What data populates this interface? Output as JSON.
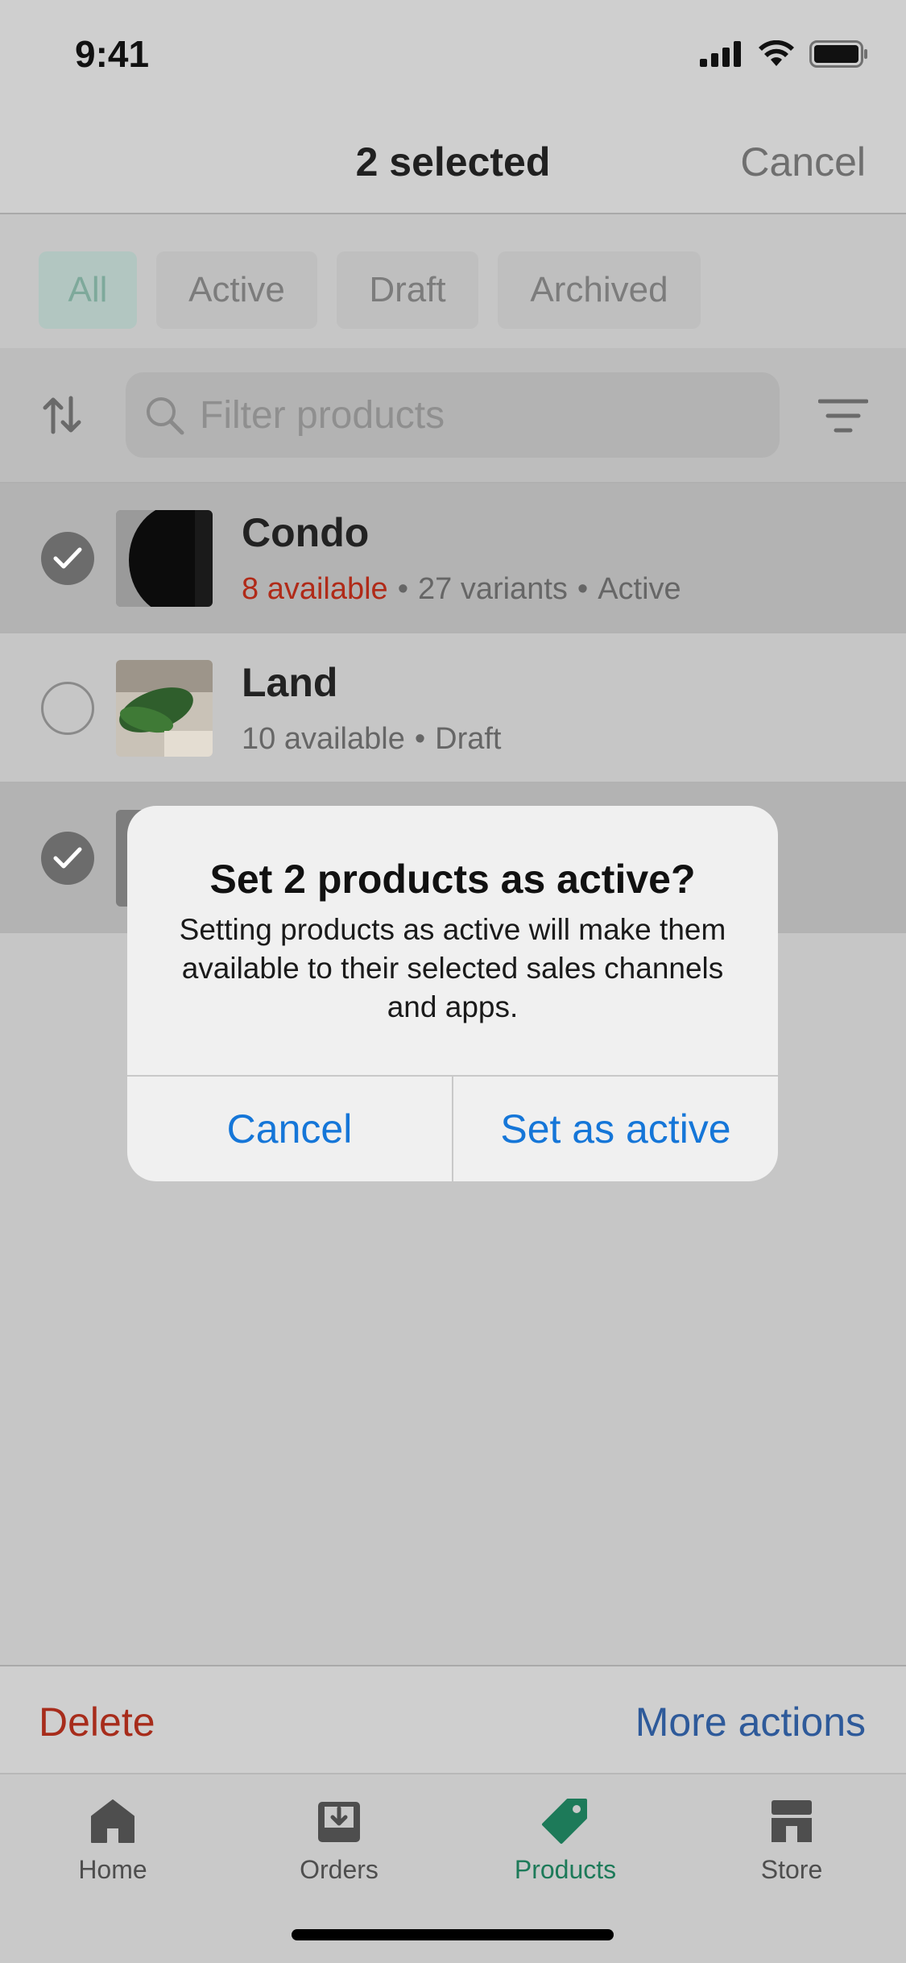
{
  "status_bar": {
    "time": "9:41"
  },
  "navbar": {
    "title": "2 selected",
    "cancel_label": "Cancel"
  },
  "tabs": [
    {
      "label": "All",
      "active": true
    },
    {
      "label": "Active",
      "active": false
    },
    {
      "label": "Draft",
      "active": false
    },
    {
      "label": "Archived",
      "active": false
    }
  ],
  "search": {
    "placeholder": "Filter products"
  },
  "products": [
    {
      "name": "Condo",
      "available": "8 available",
      "variants": "27 variants",
      "status": "Active",
      "selected": true
    },
    {
      "name": "Land",
      "available": "10 available",
      "status": "Draft",
      "selected": false
    },
    {
      "name": "",
      "selected": true
    }
  ],
  "dialog": {
    "title": "Set 2 products as active?",
    "message": "Setting products as active will make them available to their selected sales channels and apps.",
    "cancel_label": "Cancel",
    "confirm_label": "Set as active"
  },
  "action_bar": {
    "delete_label": "Delete",
    "more_label": "More actions"
  },
  "tabbar": [
    {
      "label": "Home",
      "icon": "home-icon",
      "active": false
    },
    {
      "label": "Orders",
      "icon": "orders-icon",
      "active": false
    },
    {
      "label": "Products",
      "icon": "tag-icon",
      "active": true
    },
    {
      "label": "Store",
      "icon": "store-icon",
      "active": false
    }
  ],
  "colors": {
    "accent": "#1d7a59",
    "destructive": "#a72c1b",
    "link": "#1576d8",
    "unavailable": "#b02a18"
  }
}
